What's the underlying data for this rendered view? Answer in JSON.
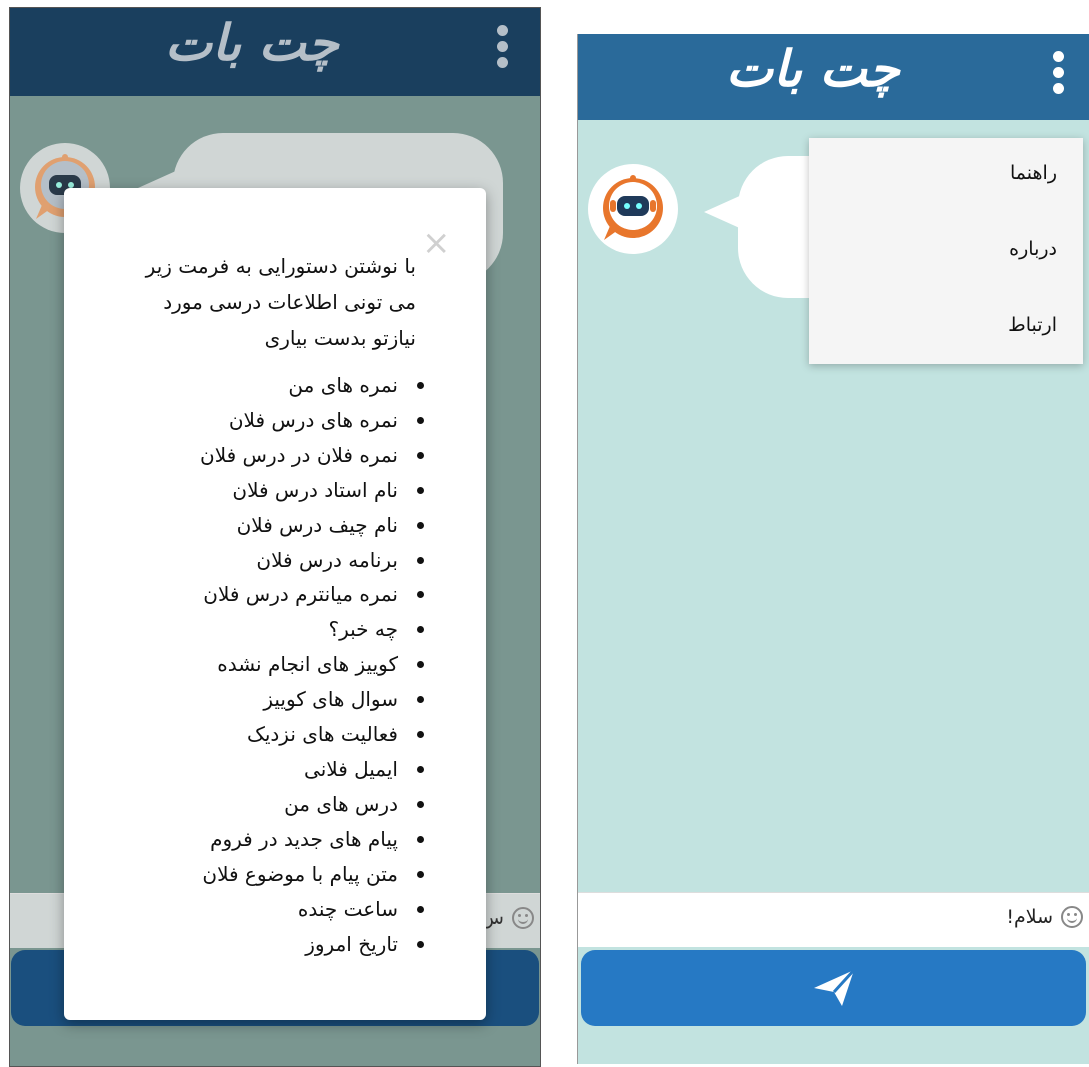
{
  "left_screen": {
    "app_title": "چت بات",
    "input_text": "س",
    "help_modal": {
      "close_symbol": "×",
      "intro_lines": [
        "با نوشتن دستورایی به فرمت زیر",
        "می تونی اطلاعات درسی مورد",
        "نیازتو بدست بیاری"
      ],
      "commands": [
        "نمره های من",
        "نمره های درس فلان",
        "نمره فلان در درس فلان",
        "نام استاد درس فلان",
        "نام چیف درس فلان",
        "برنامه درس فلان",
        "نمره میانترم درس فلان",
        "چه خبر؟",
        "کوییز های انجام نشده",
        "سوال های کوییز",
        "فعالیت های نزدیک",
        "ایمیل فلانی",
        "درس های من",
        "پیام های جدید در فروم",
        "متن پیام با موضوع فلان",
        "ساعت چنده",
        "تاریخ امروز"
      ]
    }
  },
  "right_screen": {
    "app_title": "چت بات",
    "menu_items": [
      "راهنما",
      "درباره",
      "ارتباط"
    ],
    "input_text": "سلام!"
  },
  "colors": {
    "header_right": "#2a6a9a",
    "header_left_dimmed": "#1a3f5e",
    "chat_bg": "#c2e3e0",
    "send_button": "#2679c4",
    "bot_orange": "#e8762c"
  },
  "icons": [
    "kebab-menu-icon",
    "bot-avatar-icon",
    "smiley-icon",
    "send-icon",
    "close-icon"
  ]
}
